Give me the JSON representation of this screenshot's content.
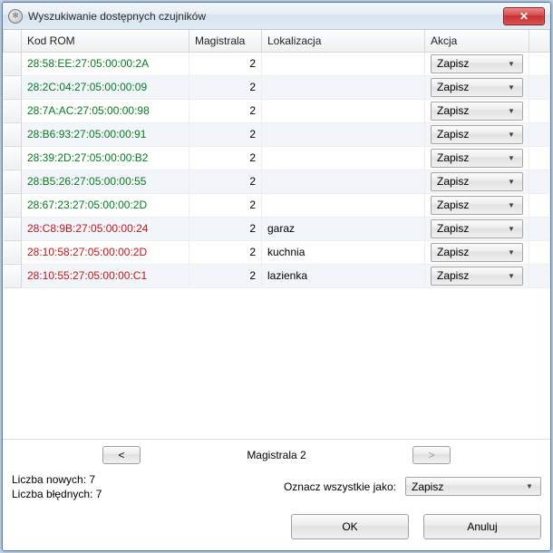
{
  "window": {
    "title": "Wyszukiwanie dostępnych czujników"
  },
  "table": {
    "columns": {
      "rom": "Kod ROM",
      "bus": "Magistrala",
      "loc": "Lokalizacja",
      "action": "Akcja"
    },
    "action_value": "Zapisz",
    "rows": [
      {
        "rom": "28:58:EE:27:05:00:00:2A",
        "bus": "2",
        "loc": "",
        "status": "new"
      },
      {
        "rom": "28:2C:04:27:05:00:00:09",
        "bus": "2",
        "loc": "",
        "status": "new"
      },
      {
        "rom": "28:7A:AC:27:05:00:00:98",
        "bus": "2",
        "loc": "",
        "status": "new"
      },
      {
        "rom": "28:B6:93:27:05:00:00:91",
        "bus": "2",
        "loc": "",
        "status": "new"
      },
      {
        "rom": "28:39:2D:27:05:00:00:B2",
        "bus": "2",
        "loc": "",
        "status": "new"
      },
      {
        "rom": "28:B5:26:27:05:00:00:55",
        "bus": "2",
        "loc": "",
        "status": "new"
      },
      {
        "rom": "28:67:23:27:05:00:00:2D",
        "bus": "2",
        "loc": "",
        "status": "new"
      },
      {
        "rom": "28:C8:9B:27:05:00:00:24",
        "bus": "2",
        "loc": "garaz",
        "status": "err"
      },
      {
        "rom": "28:10:58:27:05:00:00:2D",
        "bus": "2",
        "loc": "kuchnia",
        "status": "err"
      },
      {
        "rom": "28:10:55:27:05:00:00:C1",
        "bus": "2",
        "loc": "lazienka",
        "status": "err"
      }
    ]
  },
  "nav": {
    "prev": "<",
    "label": "Magistrala 2",
    "next": ">"
  },
  "counts": {
    "new": "Liczba nowych: 7",
    "err": "Liczba błędnych: 7"
  },
  "mark_all": {
    "label": "Oznacz wszystkie jako:",
    "value": "Zapisz"
  },
  "buttons": {
    "ok": "OK",
    "cancel": "Anuluj"
  }
}
